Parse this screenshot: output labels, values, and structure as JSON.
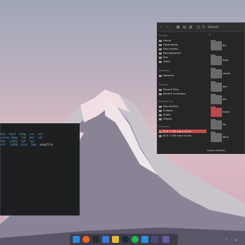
{
  "terminal": {
    "lines": [
      {
        "cols": [
          "bin",
          "boot",
          "snap",
          "srv",
          "usr"
        ]
      },
      {
        "cols": [
          "cdrom",
          "home",
          "lib",
          "mnt",
          "var"
        ]
      },
      {
        "cols": [
          "dev",
          "lib32",
          "opt",
          "sys"
        ]
      },
      {
        "cols": [
          "etc",
          "lib64",
          "proc",
          "tmp",
          "swapfile"
        ]
      }
    ]
  },
  "file_manager": {
    "toolbar": {
      "back_icon": "chevron-left-icon",
      "forward_icon": "chevron-right-icon",
      "refresh_label": "Refresh"
    },
    "path": "/",
    "sidebar": {
      "places_heading": "Places",
      "places": [
        "Home",
        "Downloads",
        "Documents",
        "Development",
        "Box",
        "Trash"
      ],
      "remote_heading": "Remote",
      "remote": [
        "Network"
      ],
      "recent_heading": "Recent",
      "recent": [
        "Recent Files",
        "Recent Locations"
      ],
      "search_heading": "Search For",
      "search": [
        "Documents",
        "Images",
        "Audio",
        "Videos"
      ],
      "devices_heading": "Devices",
      "devices": [
        "825.7 GiB Hard Drive",
        "870.3 GiB Hard Drive"
      ]
    },
    "folders": [
      "bin",
      "boot",
      "cdrom",
      "dev",
      "etc",
      "home",
      "lib",
      "lib32"
    ],
    "selected_folder": "home",
    "status": "home (folder)"
  },
  "dock": {
    "icons": [
      "finder-icon",
      "firefox-icon",
      "terminal-icon",
      "files-icon",
      "thunderbird-icon",
      "steam-icon",
      "spotify-icon",
      "vscode-icon",
      "mail-icon",
      "app-icon"
    ]
  },
  "colors": {
    "accent": "#c74a4a",
    "terminal_bg": "#1d1f21"
  }
}
